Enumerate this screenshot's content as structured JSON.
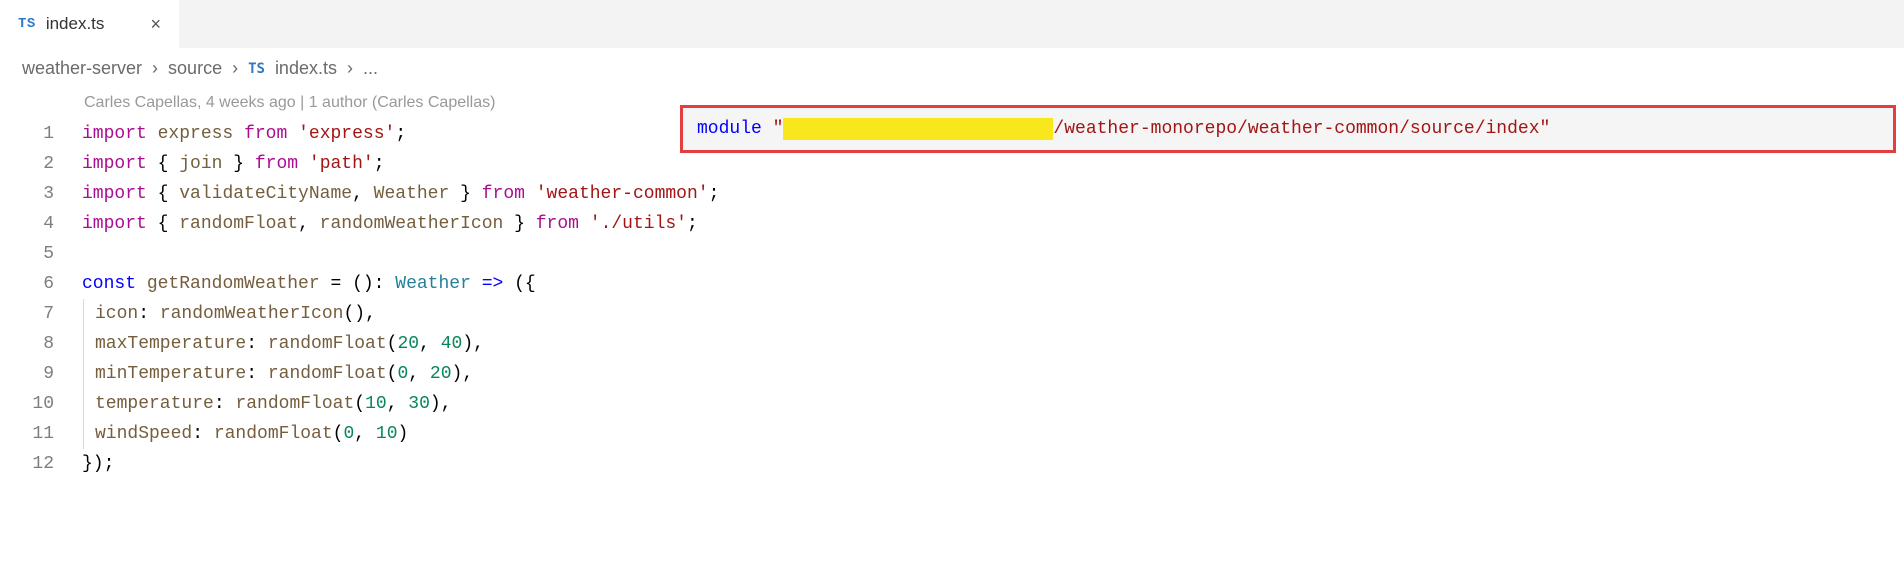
{
  "tab": {
    "icon_text": "TS",
    "label": "index.ts",
    "close_glyph": "×"
  },
  "breadcrumb": {
    "seg1": "weather-server",
    "seg2": "source",
    "icon_text": "TS",
    "seg3": "index.ts",
    "seg4": "...",
    "chev": "›"
  },
  "codelens": "Carles Capellas, 4 weeks ago | 1 author (Carles Capellas)",
  "lines": {
    "l1": {
      "import": "import",
      "id": "express",
      "from": "from",
      "str": "'express'",
      "semi": ";"
    },
    "l2": {
      "import": "import",
      "lb": "{ ",
      "id": "join",
      "rb": " }",
      "from": "from",
      "str": "'path'",
      "semi": ";"
    },
    "l3": {
      "import": "import",
      "lb": "{ ",
      "id1": "validateCityName",
      "comma": ", ",
      "id2": "Weather",
      "rb": " }",
      "from": "from",
      "str": "'weather-common'",
      "semi": ";"
    },
    "l4": {
      "import": "import",
      "lb": "{ ",
      "id1": "randomFloat",
      "comma": ", ",
      "id2": "randomWeatherIcon",
      "rb": " }",
      "from": "from",
      "str": "'./utils'",
      "semi": ";"
    },
    "l6": {
      "const": "const",
      "name": "getRandomWeather",
      "eq": " = ",
      "paren": "()",
      "colon": ": ",
      "type": "Weather",
      "arrow": " => ",
      "open": "({"
    },
    "l7": {
      "prop": "icon",
      "colon": ": ",
      "fn": "randomWeatherIcon",
      "args": "()",
      "comma": ","
    },
    "l8": {
      "prop": "maxTemperature",
      "colon": ": ",
      "fn": "randomFloat",
      "lp": "(",
      "a1": "20",
      "c": ", ",
      "a2": "40",
      "rp": ")",
      "comma": ","
    },
    "l9": {
      "prop": "minTemperature",
      "colon": ": ",
      "fn": "randomFloat",
      "lp": "(",
      "a1": "0",
      "c": ", ",
      "a2": "20",
      "rp": ")",
      "comma": ","
    },
    "l10": {
      "prop": "temperature",
      "colon": ": ",
      "fn": "randomFloat",
      "lp": "(",
      "a1": "10",
      "c": ", ",
      "a2": "30",
      "rp": ")",
      "comma": ","
    },
    "l11": {
      "prop": "windSpeed",
      "colon": ": ",
      "fn": "randomFloat",
      "lp": "(",
      "a1": "0",
      "c": ", ",
      "a2": "10",
      "rp": ")"
    },
    "l12": {
      "close": "});"
    }
  },
  "line_numbers": [
    "1",
    "2",
    "3",
    "4",
    "5",
    "6",
    "7",
    "8",
    "9",
    "10",
    "11",
    "12"
  ],
  "hover": {
    "kw": "module",
    "q1": " \"",
    "path": "/weather-monorepo/weather-common/source/index",
    "q2": "\""
  }
}
